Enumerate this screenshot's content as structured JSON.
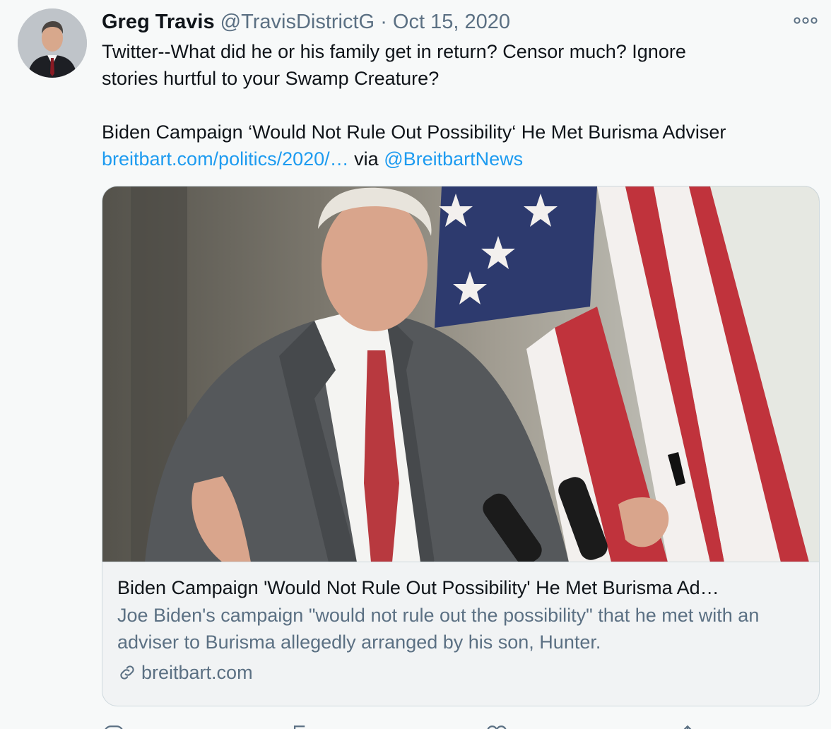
{
  "tweet": {
    "author_name": "Greg Travis",
    "author_handle": "@TravisDistrictG",
    "separator": "·",
    "date": "Oct 15, 2020",
    "body_lines": [
      "Twitter--What did he or his family get in return?  Censor much?  Ignore",
      "stories hurtful to your Swamp Creature?"
    ],
    "headline": "Biden Campaign ‘Would Not Rule Out Possibility‘ He Met Burisma Adviser",
    "link_text": "breitbart.com/politics/2020/…",
    "via_text": "via",
    "via_handle": "@BreitbartNews"
  },
  "card": {
    "title": "Biden Campaign 'Would Not Rule Out Possibility' He Met Burisma Ad…",
    "description": "Joe Biden's campaign \"would not rule out the possibility\" that he met with an adviser to Burisma allegedly arranged by his son, Hunter.",
    "domain": "breitbart.com"
  },
  "icons": {
    "more": "more-options-icon",
    "link": "link-icon",
    "reply": "reply-icon",
    "retweet": "retweet-icon",
    "like": "like-icon",
    "share": "share-icon"
  },
  "colors": {
    "background": "#f7f9f9",
    "link": "#1d9bf0",
    "secondary_text": "#5b7083",
    "border": "#cfd9de"
  }
}
